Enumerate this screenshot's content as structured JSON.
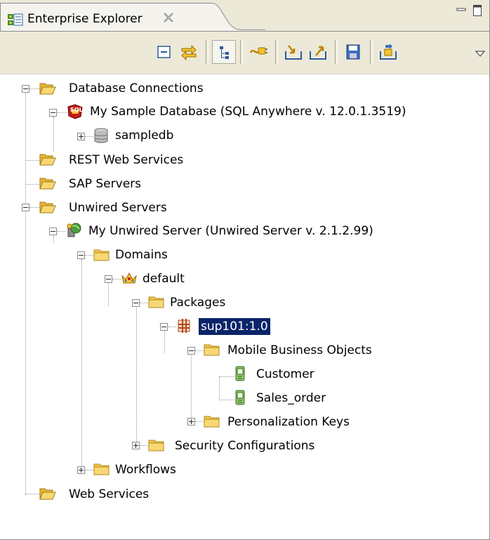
{
  "view": {
    "title": "Enterprise Explorer",
    "icons": {
      "tab": "enterprise-explorer-icon",
      "close": "close-x-icon",
      "minimize": "minimize-icon",
      "maximize": "maximize-icon",
      "view_menu": "view-menu-chevron-icon"
    }
  },
  "toolbar": {
    "items": [
      {
        "icon": "collapse-all-icon"
      },
      {
        "icon": "link-with-editor-icon"
      },
      {
        "icon": "tree-view-icon",
        "pressed": true
      },
      {
        "icon": "connect-icon"
      },
      {
        "icon": "import-icon"
      },
      {
        "icon": "export-icon"
      },
      {
        "icon": "save-icon"
      },
      {
        "icon": "deploy-icon"
      }
    ]
  },
  "tree": {
    "nodes": [
      {
        "label": "Database Connections",
        "icon": "folder-open-icon"
      },
      {
        "label": "My Sample Database (SQL Anywhere v. 12.0.1.3519)",
        "icon": "sql-database-connection-icon"
      },
      {
        "label": "sampledb",
        "icon": "database-cylinder-icon"
      },
      {
        "label": "REST Web Services",
        "icon": "folder-open-icon"
      },
      {
        "label": "SAP Servers",
        "icon": "folder-open-icon"
      },
      {
        "label": "Unwired Servers",
        "icon": "folder-open-icon"
      },
      {
        "label": "My Unwired Server (Unwired Server v. 2.1.2.99)",
        "icon": "unwired-server-icon"
      },
      {
        "label": "Domains",
        "icon": "folder-icon"
      },
      {
        "label": "default",
        "icon": "crown-domain-icon"
      },
      {
        "label": "Packages",
        "icon": "folder-icon"
      },
      {
        "label": "sup101:1.0",
        "icon": "package-grid-icon",
        "selected": true
      },
      {
        "label": "Mobile Business Objects",
        "icon": "folder-icon"
      },
      {
        "label": "Customer",
        "icon": "mobile-business-object-icon"
      },
      {
        "label": "Sales_order",
        "icon": "mobile-business-object-icon"
      },
      {
        "label": "Personalization Keys",
        "icon": "folder-icon"
      },
      {
        "label": "Security Configurations",
        "icon": "folder-icon"
      },
      {
        "label": "Workflows",
        "icon": "folder-icon"
      },
      {
        "label": "Web Services",
        "icon": "folder-open-icon"
      }
    ]
  },
  "colors": {
    "selection_bg": "#0a246a",
    "selection_fg": "#ffffff",
    "toolbar_bg": "#ece9d8",
    "folder": "#f3c64a"
  }
}
